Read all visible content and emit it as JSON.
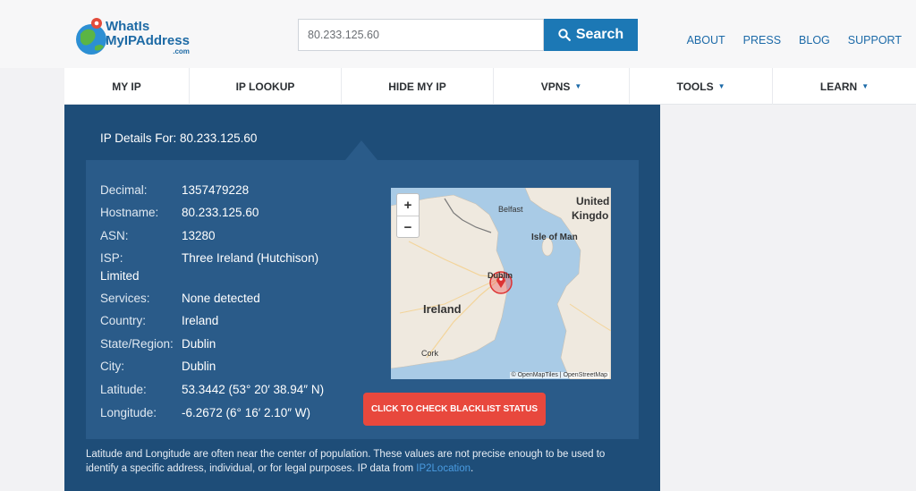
{
  "logo": {
    "line1": "WhatIs",
    "line2": "MyIPAddress",
    "line3": ".com"
  },
  "search": {
    "value": "80.233.125.60",
    "button_label": "Search"
  },
  "top_links": [
    "ABOUT",
    "PRESS",
    "BLOG",
    "SUPPORT"
  ],
  "nav": [
    {
      "label": "MY IP",
      "dropdown": false
    },
    {
      "label": "IP LOOKUP",
      "dropdown": false
    },
    {
      "label": "HIDE MY IP",
      "dropdown": false
    },
    {
      "label": "VPNS",
      "dropdown": true
    },
    {
      "label": "TOOLS",
      "dropdown": true
    },
    {
      "label": "LEARN",
      "dropdown": true
    }
  ],
  "ip_details_for": "IP Details For: 80.233.125.60",
  "details": {
    "decimal": {
      "label": "Decimal:",
      "value": "1357479228"
    },
    "hostname": {
      "label": "Hostname:",
      "value": "80.233.125.60"
    },
    "asn": {
      "label": "ASN:",
      "value": "13280"
    },
    "isp": {
      "label": "ISP:",
      "value": "Three Ireland (Hutchison)",
      "value_cont": "Limited"
    },
    "services": {
      "label": "Services:",
      "value": "None detected"
    },
    "country": {
      "label": "Country:",
      "value": "Ireland"
    },
    "state": {
      "label": "State/Region:",
      "value": "Dublin"
    },
    "city": {
      "label": "City:",
      "value": "Dublin"
    },
    "latitude": {
      "label": "Latitude:",
      "value": "53.3442  (53° 20′ 38.94″ N)"
    },
    "longitude": {
      "label": "Longitude:",
      "value": "-6.2672  (6° 16′ 2.10″ W)"
    }
  },
  "map": {
    "zoom_in": "+",
    "zoom_out": "−",
    "labels": {
      "belfast": "Belfast",
      "uk1": "United",
      "uk2": "Kingdo",
      "isle_of_man": "Isle of Man",
      "dublin": "Dublin",
      "ireland": "Ireland",
      "cork": "Cork"
    },
    "attribution": "© OpenMapTiles | OpenStreetMap"
  },
  "blacklist_button": "CLICK TO CHECK BLACKLIST STATUS",
  "note": {
    "text": "Latitude and Longitude are often near the center of population. These values are not precise enough to be used to identify a specific address, individual, or for legal purposes. IP data from ",
    "link": "IP2Location",
    "end": "."
  },
  "colors": {
    "panel": "#1e4d78",
    "details_box": "#2a5b89",
    "accent": "#1c78b5",
    "button_red": "#e8483d"
  }
}
